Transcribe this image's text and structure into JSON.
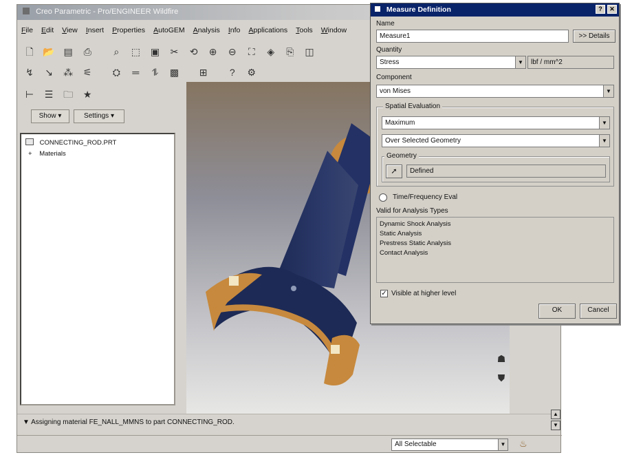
{
  "app": {
    "title": "Creo Parametric - Pro/ENGINEER Wildfire",
    "menu": [
      "File",
      "Edit",
      "View",
      "Insert",
      "Properties",
      "AutoGEM",
      "Analysis",
      "Info",
      "Applications",
      "Tools",
      "Window"
    ],
    "tree_tabs": {
      "show": "Show ▾",
      "settings": "Settings ▾"
    },
    "tree": {
      "root": "CONNECTING_ROD.PRT",
      "items": [
        "Materials"
      ]
    },
    "status_message": "▼ Assigning material FE_NALL_MMNS to part CONNECTING_ROD.",
    "filter": {
      "value": "All Selectable"
    }
  },
  "dialog": {
    "title": "Measure Definition",
    "name_label": "Name",
    "name_value": "Measure1",
    "details_label": ">> Details",
    "quantity_label": "Quantity",
    "quantity_value": "Stress",
    "quantity_unit": "lbf / mm^2",
    "component_label": "Component",
    "component_value": "von Mises",
    "spatial_label": "Spatial Evaluation",
    "spatial_value": "Maximum",
    "spatial_scope": "Over Selected Geometry",
    "geometry_label": "Geometry",
    "geometry_value": "Defined",
    "time_freq_label": "Time/Frequency Eval",
    "valid_label": "Valid for Analysis Types",
    "analysis_types": [
      "Dynamic Shock Analysis",
      "Static Analysis",
      "Prestress Static Analysis",
      "Contact Analysis"
    ],
    "visible_label": "Visible at higher level",
    "ok_label": "OK",
    "cancel_label": "Cancel"
  }
}
